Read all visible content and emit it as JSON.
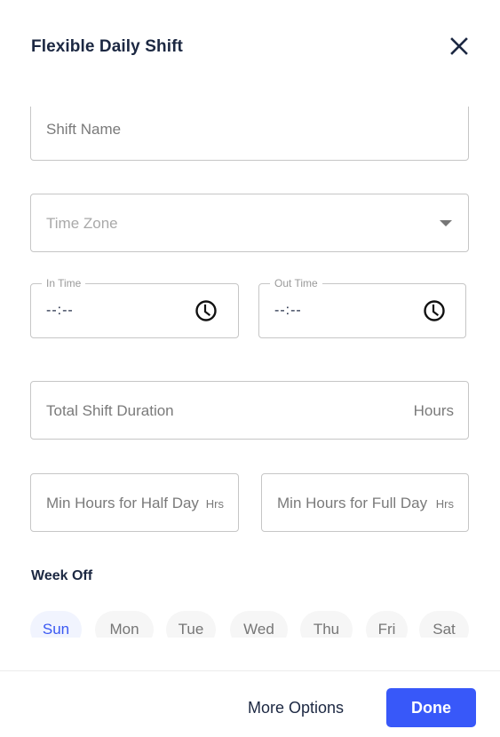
{
  "dialog": {
    "title": "Flexible Daily Shift",
    "close_icon": "close-icon"
  },
  "form": {
    "shift_name": {
      "placeholder": "Shift Name",
      "value": ""
    },
    "time_zone": {
      "placeholder": "Time Zone",
      "value": "",
      "icon": "dropdown-arrow-icon"
    },
    "in_time": {
      "label": "In Time",
      "value": "--:--",
      "icon": "clock-icon"
    },
    "out_time": {
      "label": "Out Time",
      "value": "--:--",
      "icon": "clock-icon"
    },
    "total_duration": {
      "placeholder": "Total Shift Duration",
      "suffix": "Hours",
      "value": ""
    },
    "min_half_day": {
      "placeholder": "Min Hours for Half Day",
      "suffix": "Hrs",
      "value": ""
    },
    "min_full_day": {
      "placeholder": "Min Hours for Full Day",
      "suffix": "Hrs",
      "value": ""
    }
  },
  "week_off": {
    "label": "Week Off",
    "days": [
      {
        "label": "Sun",
        "selected": true
      },
      {
        "label": "Mon",
        "selected": false
      },
      {
        "label": "Tue",
        "selected": false
      },
      {
        "label": "Wed",
        "selected": false
      },
      {
        "label": "Thu",
        "selected": false
      },
      {
        "label": "Fri",
        "selected": false
      },
      {
        "label": "Sat",
        "selected": false
      }
    ]
  },
  "footer": {
    "more_options_label": "More Options",
    "done_label": "Done"
  },
  "colors": {
    "primary": "#3858f9",
    "selected_day_bg": "#f1f4fe",
    "heading": "#1c2842"
  }
}
